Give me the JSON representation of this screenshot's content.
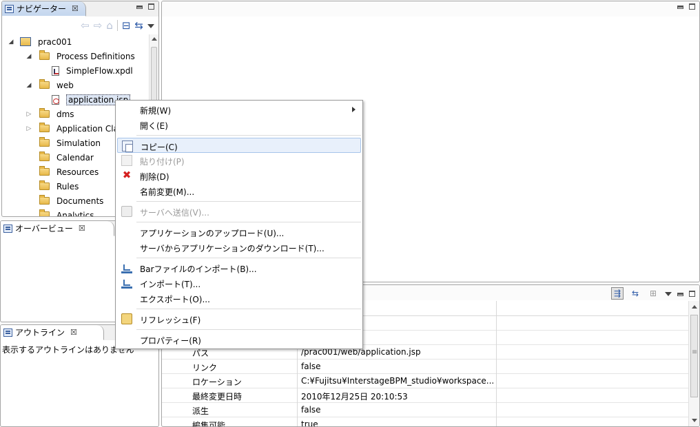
{
  "navigator": {
    "title": "ナビゲーター",
    "close": "☒",
    "toolbar": {
      "back": "⇦",
      "forward": "⇨",
      "home": "⌂",
      "collapse": "⊟",
      "link": "⇆"
    },
    "tree": [
      {
        "label": "prac001",
        "level": 0,
        "state": "open",
        "kind": "project"
      },
      {
        "label": "Process Definitions",
        "level": 1,
        "state": "open",
        "kind": "folder"
      },
      {
        "label": "SimpleFlow.xpdl",
        "level": 2,
        "state": "none",
        "kind": "xpdl"
      },
      {
        "label": "web",
        "level": 1,
        "state": "open",
        "kind": "folder-plain"
      },
      {
        "label": "application.jsp",
        "level": 2,
        "state": "none",
        "kind": "jsp",
        "selected": true
      },
      {
        "label": "dms",
        "level": 1,
        "state": "closed",
        "kind": "folder"
      },
      {
        "label": "Application Cla",
        "level": 1,
        "state": "closed",
        "kind": "folder"
      },
      {
        "label": "Simulation",
        "level": 1,
        "state": "none",
        "kind": "folder"
      },
      {
        "label": "Calendar",
        "level": 1,
        "state": "none",
        "kind": "folder"
      },
      {
        "label": "Resources",
        "level": 1,
        "state": "none",
        "kind": "folder"
      },
      {
        "label": "Rules",
        "level": 1,
        "state": "none",
        "kind": "folder"
      },
      {
        "label": "Documents",
        "level": 1,
        "state": "none",
        "kind": "folder"
      },
      {
        "label": "Analytics",
        "level": 1,
        "state": "none",
        "kind": "folder"
      }
    ]
  },
  "overview": {
    "title": "オーバービュー",
    "close": "☒"
  },
  "outline": {
    "title": "アウトライン",
    "close": "☒",
    "empty_message": "表示するアウトラインはありません"
  },
  "properties": {
    "toolbar": {
      "categories": "⇶",
      "advanced": "⇆",
      "restore": "⊞"
    },
    "rows": [
      {
        "key": "パス",
        "value": "/prac001/web/application.jsp"
      },
      {
        "key": "リンク",
        "value": "false"
      },
      {
        "key": "ロケーション",
        "value": "C:¥Fujitsu¥InterstageBPM_studio¥workspace..."
      },
      {
        "key": "最終変更日時",
        "value": "2010年12月25日 20:10:53"
      },
      {
        "key": "派生",
        "value": "false"
      },
      {
        "key": "編集可能",
        "value": "true"
      }
    ]
  },
  "context_menu": {
    "items": [
      {
        "label": "新規(W)",
        "icon": "",
        "submenu": true,
        "disabled": false
      },
      {
        "label": "開く(E)",
        "icon": "",
        "disabled": false
      },
      {
        "sep": true
      },
      {
        "label": "コピー(C)",
        "icon": "copy-icon",
        "disabled": false,
        "hover": true
      },
      {
        "label": "貼り付け(P)",
        "icon": "paste-icon",
        "disabled": true
      },
      {
        "label": "削除(D)",
        "icon": "delete-icon",
        "disabled": false
      },
      {
        "label": "名前変更(M)...",
        "icon": "",
        "disabled": false
      },
      {
        "sep": true
      },
      {
        "label": "サーバへ送信(V)...",
        "icon": "send-icon",
        "disabled": true
      },
      {
        "sep": true
      },
      {
        "label": "アプリケーションのアップロード(U)...",
        "icon": "",
        "disabled": false
      },
      {
        "label": "サーバからアプリケーションのダウンロード(T)...",
        "icon": "",
        "disabled": false
      },
      {
        "sep": true
      },
      {
        "label": "Barファイルのインポート(B)...",
        "icon": "import-icon",
        "disabled": false
      },
      {
        "label": "インポート(T)...",
        "icon": "import-icon",
        "disabled": false
      },
      {
        "label": "エクスポート(O)...",
        "icon": "",
        "disabled": false
      },
      {
        "sep": true
      },
      {
        "label": "リフレッシュ(F)",
        "icon": "refresh-icon",
        "disabled": false
      },
      {
        "sep": true
      },
      {
        "label": "プロパティー(R)",
        "icon": "",
        "disabled": false
      }
    ]
  }
}
